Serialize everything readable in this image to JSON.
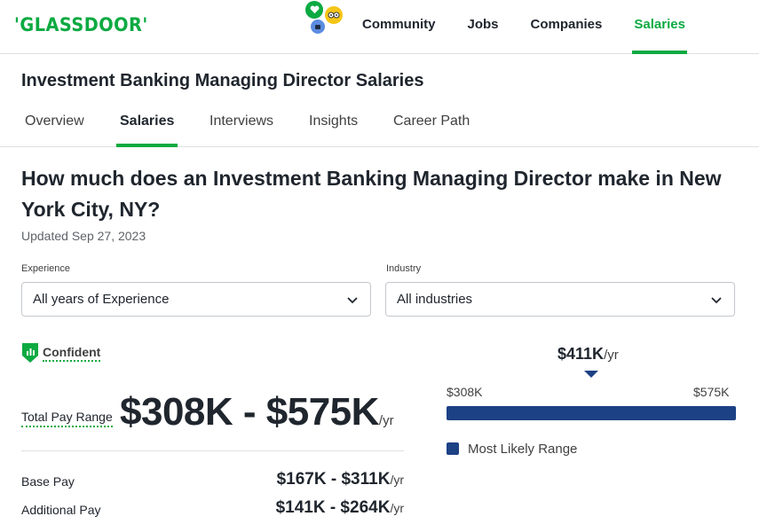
{
  "brand": {
    "logo": "'GLASSDOOR'",
    "green": "#0caa41",
    "blue": "#1d4185"
  },
  "nav": {
    "icons": [
      "heart-icon",
      "owl-icon",
      "bot-icon"
    ],
    "links": [
      {
        "label": "Community"
      },
      {
        "label": "Jobs"
      },
      {
        "label": "Companies"
      },
      {
        "label": "Salaries",
        "active": true
      }
    ]
  },
  "job": {
    "title": "Investment Banking Managing Director Salaries",
    "tabs": [
      {
        "label": "Overview"
      },
      {
        "label": "Salaries",
        "active": true
      },
      {
        "label": "Interviews"
      },
      {
        "label": "Insights"
      },
      {
        "label": "Career Path"
      }
    ]
  },
  "main": {
    "headline": "How much does an Investment Banking Managing Director make in New York City, NY?",
    "updated": "Updated Sep 27, 2023"
  },
  "filters": {
    "experience": {
      "label": "Experience",
      "value": "All years of Experience"
    },
    "industry": {
      "label": "Industry",
      "value": "All industries"
    }
  },
  "confidence": {
    "label": "Confident",
    "icon": "shield-chart-icon"
  },
  "pay": {
    "total": {
      "label": "Total Pay Range",
      "value": "$308K - $575K",
      "unit": "/yr"
    },
    "base": {
      "label": "Base Pay",
      "value": "$167K - $311K",
      "unit": "/yr"
    },
    "additional": {
      "label": "Additional Pay",
      "value": "$141K - $264K",
      "unit": "/yr"
    }
  },
  "range": {
    "median": "$411K",
    "median_unit": "/yr",
    "min_label": "$308K",
    "max_label": "$575K",
    "legend": "Most Likely Range"
  }
}
